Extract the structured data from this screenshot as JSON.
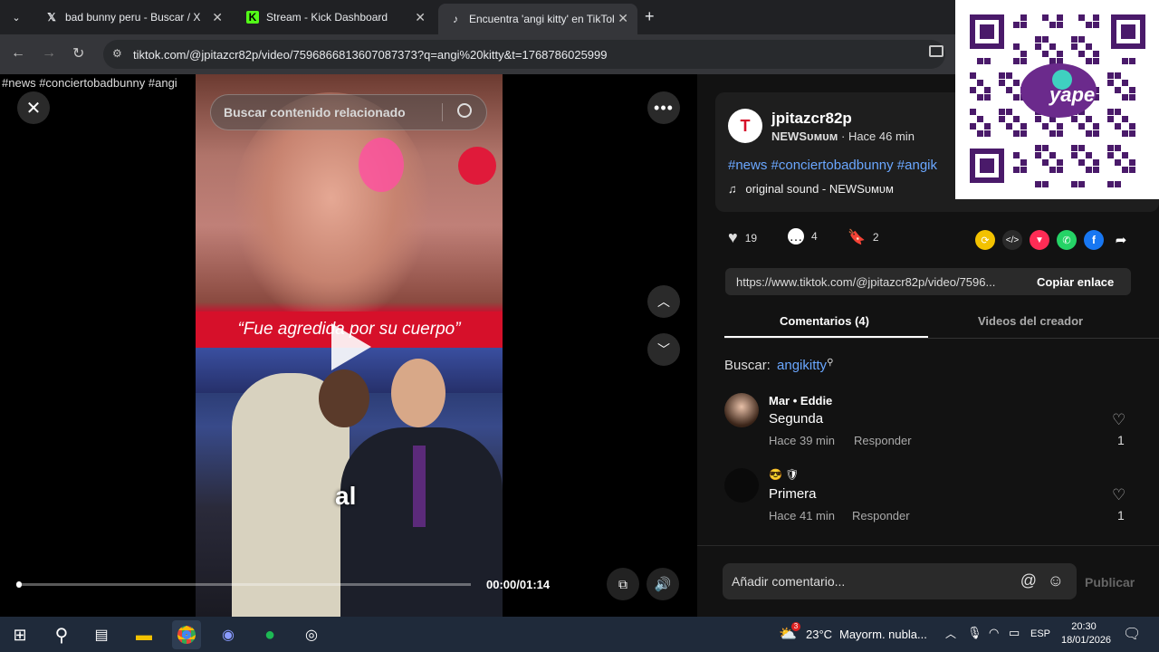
{
  "browser": {
    "tabs": [
      {
        "label": "bad bunny peru - Buscar / X",
        "icon": "x-logo-icon"
      },
      {
        "label": "Stream - Kick Dashboard",
        "icon": "kick-logo-icon"
      },
      {
        "label": "Encuentra 'angi kitty' en TikTok",
        "icon": "tiktok-logo-icon"
      }
    ],
    "url": "tiktok.com/@jpitazcr82p/video/7596866813607087373?q=angi%20kitty&t=1768786025999"
  },
  "video": {
    "top_caption": "#news #conciertobadbunny #angi",
    "search_placeholder": "Buscar contenido relacionado",
    "banner": "“Fue agredida por su cuerpo”",
    "subtitle": "al",
    "time": "00:00/01:14",
    "progress_fraction": 0.0
  },
  "post": {
    "username": "jpitazcr82p",
    "channel": "NEWSᴜᴍᴜᴍ",
    "time_ago": "· Hace 46 min",
    "hashtags": "#news #conciertobadbunny #angik",
    "sound": "original sound - NEWSᴜᴍᴜᴍ",
    "likes": "19",
    "comments": "4",
    "saves": "2",
    "share_url": "https://www.tiktok.com/@jpitazcr82p/video/7596...",
    "copy_link": "Copiar enlace",
    "tab_comments": "Comentarios (4)",
    "tab_creator": "Videos del creador",
    "search_label": "Buscar:",
    "search_term": "angikitty"
  },
  "comments": [
    {
      "user": "Mar • Eddie",
      "text": "Segunda",
      "time": "Hace 39 min",
      "reply": "Responder",
      "likes": "1"
    },
    {
      "user": "😎 🛡",
      "text": "Primera",
      "time": "Hace 41 min",
      "reply": "Responder",
      "likes": "1"
    }
  ],
  "composer": {
    "placeholder": "Añadir comentario...",
    "publish": "Publicar"
  },
  "taskbar": {
    "temp": "23°C",
    "weather": "Mayorm. nubla...",
    "lang": "ESP",
    "time": "20:30",
    "date": "18/01/2026",
    "weather_badge": "3"
  },
  "colors": {
    "accent": "#fe2c55",
    "hashtag": "#6aa7ff",
    "yape": "#6b2a8c"
  }
}
